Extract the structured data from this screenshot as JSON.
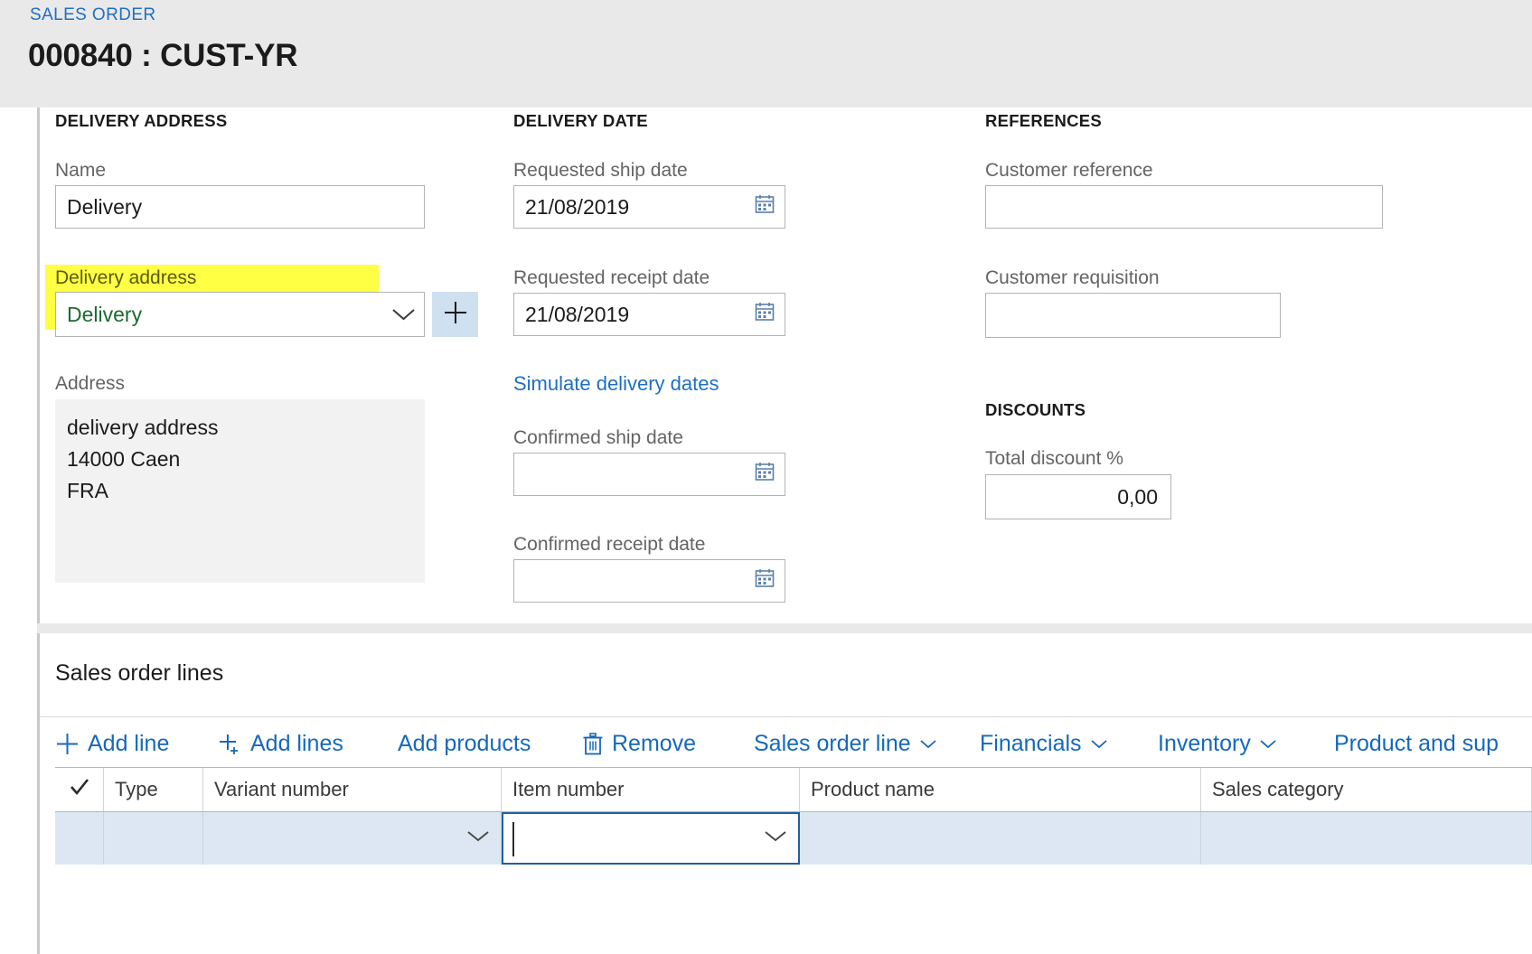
{
  "header": {
    "breadcrumb": "SALES ORDER",
    "title": "000840 : CUST-YR"
  },
  "colors": {
    "accent_link": "#1f6fc4",
    "highlight": "#ffff44",
    "highlight_text": "#1b6b33",
    "page_chrome": "#e9e9e9",
    "row_selected": "#dce7f3",
    "focus_border": "#1f5fa8",
    "plus_button_bg": "#cfe0f0"
  },
  "delivery_address": {
    "section_title": "DELIVERY ADDRESS",
    "name": {
      "label": "Name",
      "value": "Delivery",
      "placeholder": ""
    },
    "delivery_address": {
      "label": "Delivery address",
      "value": "Delivery",
      "placeholder": "",
      "highlighted": true,
      "chevron_icon": "chevron-down-icon",
      "add_button_icon": "plus-icon"
    },
    "address": {
      "label": "Address",
      "lines": [
        "delivery address",
        "14000 Caen",
        "FRA"
      ]
    }
  },
  "delivery_date": {
    "section_title": "DELIVERY DATE",
    "requested_ship_date": {
      "label": "Requested ship date",
      "value": "21/08/2019",
      "icon": "calendar-icon"
    },
    "requested_receipt_date": {
      "label": "Requested receipt date",
      "value": "21/08/2019",
      "icon": "calendar-icon"
    },
    "simulate_link": "Simulate delivery dates",
    "confirmed_ship_date": {
      "label": "Confirmed ship date",
      "value": "",
      "icon": "calendar-icon"
    },
    "confirmed_receipt_date": {
      "label": "Confirmed receipt date",
      "value": "",
      "icon": "calendar-icon"
    }
  },
  "references": {
    "section_title": "REFERENCES",
    "customer_reference": {
      "label": "Customer reference",
      "value": "",
      "placeholder": ""
    },
    "customer_requisition": {
      "label": "Customer requisition",
      "value": "",
      "placeholder": ""
    }
  },
  "discounts": {
    "section_title": "DISCOUNTS",
    "total_discount": {
      "label": "Total discount %",
      "value": "0,00"
    }
  },
  "sales_order_lines": {
    "title": "Sales order lines",
    "toolbar": [
      {
        "label": "Add line",
        "icon": "plus-icon",
        "has_chevron": false
      },
      {
        "label": "Add lines",
        "icon": "add-lines-icon",
        "has_chevron": false
      },
      {
        "label": "Add products",
        "icon": "",
        "has_chevron": false
      },
      {
        "label": "Remove",
        "icon": "trash-icon",
        "has_chevron": false
      },
      {
        "label": "Sales order line",
        "icon": "",
        "has_chevron": true
      },
      {
        "label": "Financials",
        "icon": "",
        "has_chevron": true
      },
      {
        "label": "Inventory",
        "icon": "",
        "has_chevron": true
      },
      {
        "label": "Product and sup",
        "icon": "",
        "has_chevron": true
      }
    ],
    "columns": [
      {
        "label": "",
        "icon": "checkmark-icon"
      },
      {
        "label": "Type"
      },
      {
        "label": "Variant number"
      },
      {
        "label": "Item number"
      },
      {
        "label": "Product name"
      },
      {
        "label": "Sales category"
      }
    ],
    "rows": [
      {
        "selected": true,
        "cells": [
          {
            "value": ""
          },
          {
            "value": ""
          },
          {
            "value": "",
            "has_chevron": true
          },
          {
            "value": "",
            "has_chevron": true,
            "focused": true,
            "caret": true
          },
          {
            "value": ""
          },
          {
            "value": ""
          }
        ]
      }
    ]
  }
}
